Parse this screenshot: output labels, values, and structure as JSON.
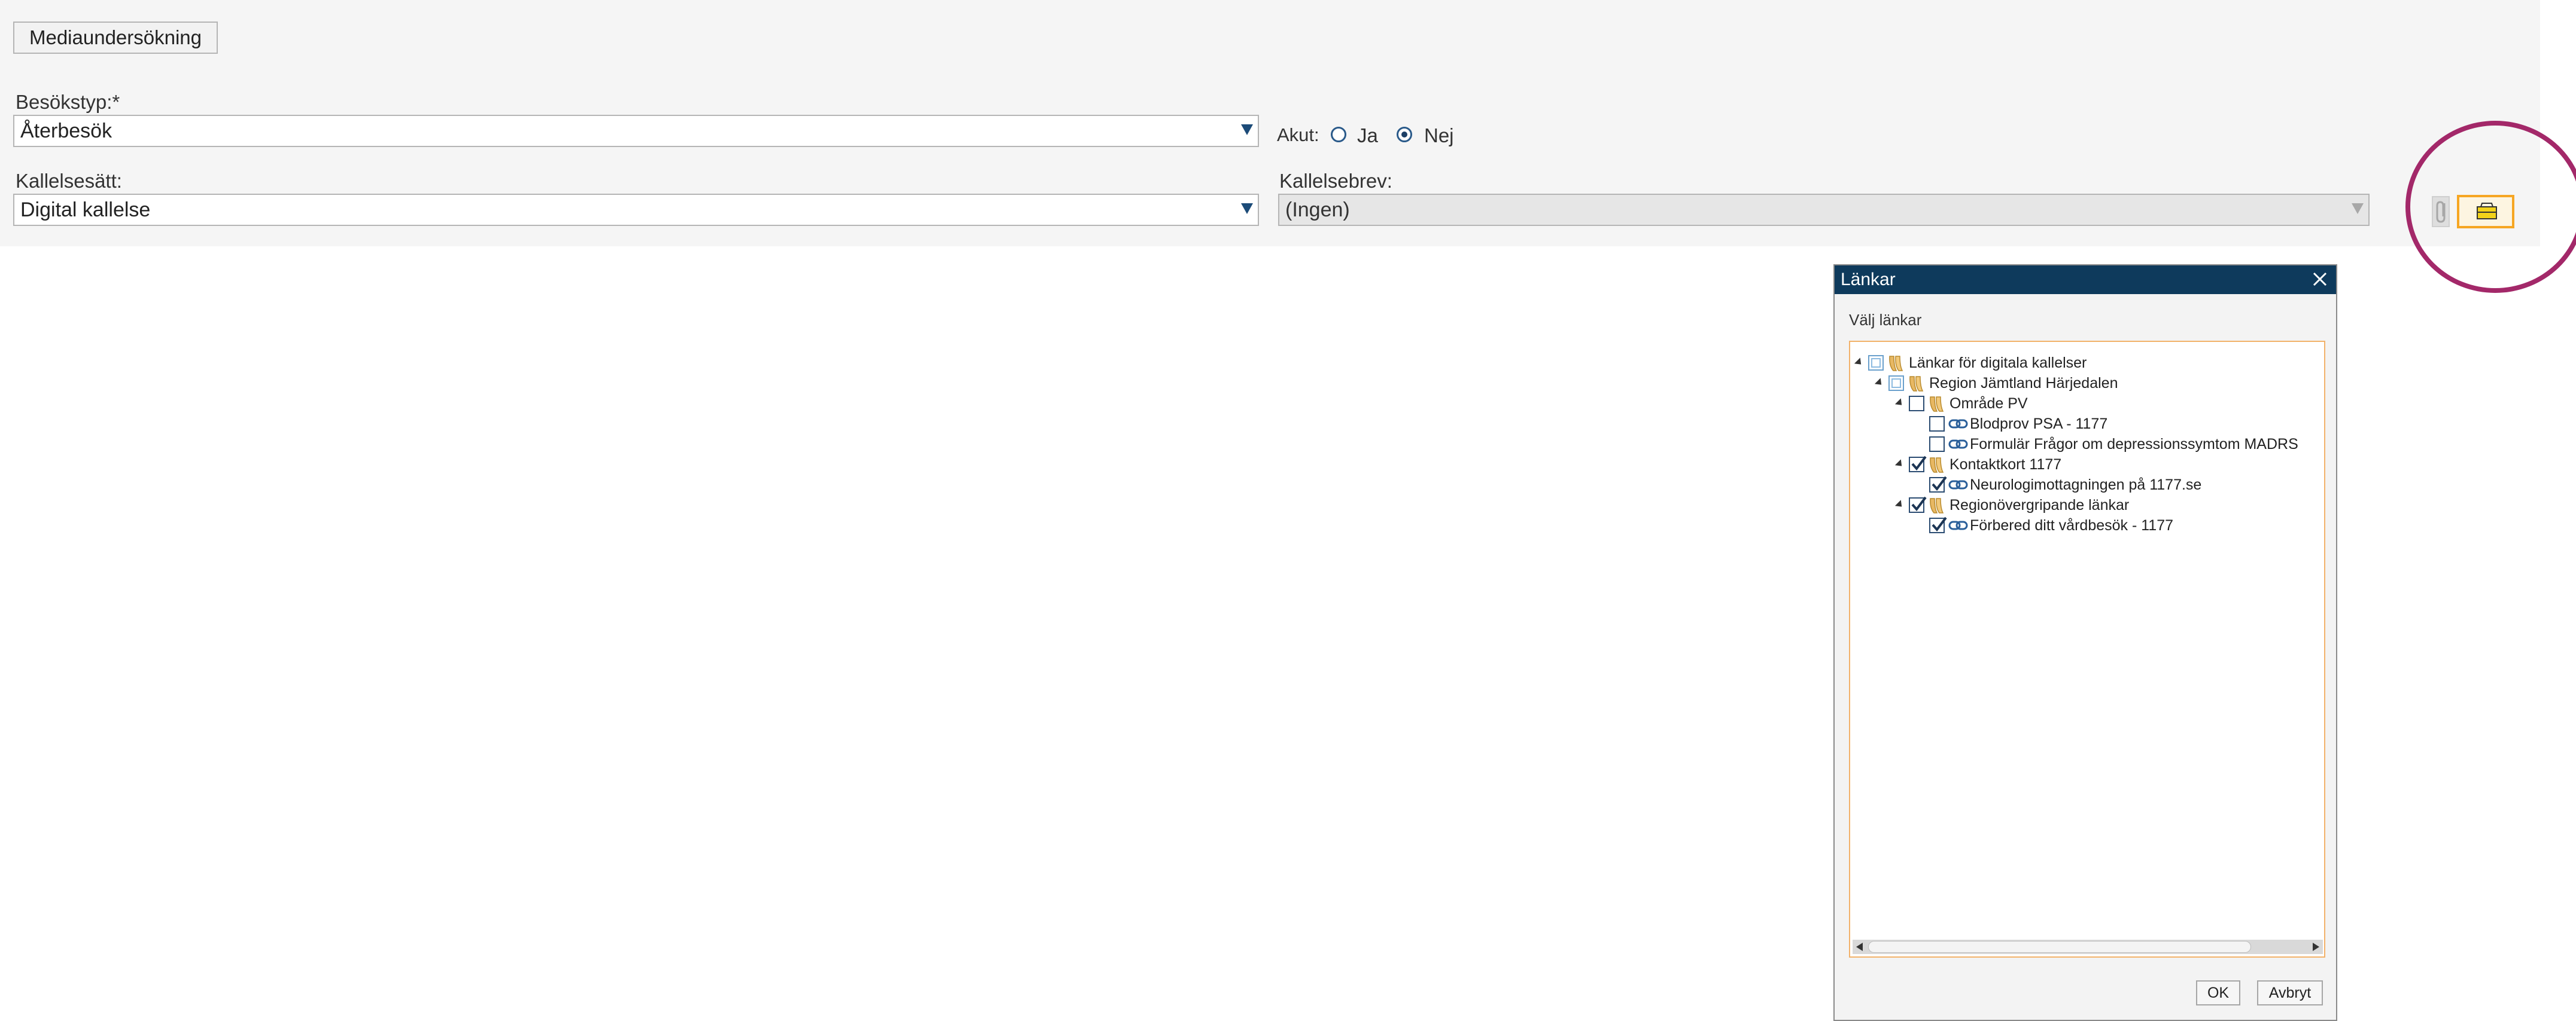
{
  "toolbar": {
    "media_button": "Mediaundersökning"
  },
  "form": {
    "visit_type": {
      "label": "Besökstyp:*",
      "value": "Återbesök"
    },
    "acute": {
      "label": "Akut:",
      "options": [
        "Ja",
        "Nej"
      ],
      "selected": "Nej"
    },
    "call_method": {
      "label": "Kallelsesätt:",
      "value": "Digital kallelse"
    },
    "call_letter": {
      "label": "Kallelsebrev:",
      "value": "(Ingen)"
    }
  },
  "dialog": {
    "title": "Länkar",
    "subtitle": "Välj länkar",
    "tree": [
      {
        "label": "Länkar för digitala kallelser",
        "state": "partial",
        "icon": "folder-icon"
      },
      {
        "label": "Region Jämtland Härjedalen",
        "state": "partial",
        "icon": "folder-icon"
      },
      {
        "label": "Område PV",
        "state": "unchecked",
        "icon": "folder-icon"
      },
      {
        "label": "Blodprov PSA - 1177",
        "state": "unchecked",
        "icon": "link-icon"
      },
      {
        "label": "Formulär Frågor om depressionssymtom MADRS",
        "state": "unchecked",
        "icon": "link-icon"
      },
      {
        "label": "Kontaktkort 1177",
        "state": "checked",
        "icon": "folder-icon"
      },
      {
        "label": "Neurologimottagningen på 1177.se",
        "state": "checked",
        "icon": "link-icon"
      },
      {
        "label": "Regionövergripande länkar",
        "state": "checked",
        "icon": "folder-icon"
      },
      {
        "label": "Förbered ditt vårdbesök - 1177",
        "state": "checked",
        "icon": "link-icon"
      }
    ],
    "ok_label": "OK",
    "cancel_label": "Avbryt"
  },
  "colors": {
    "accent": "#0e3a5c",
    "highlight": "#a32869",
    "focus": "#f6a623"
  }
}
